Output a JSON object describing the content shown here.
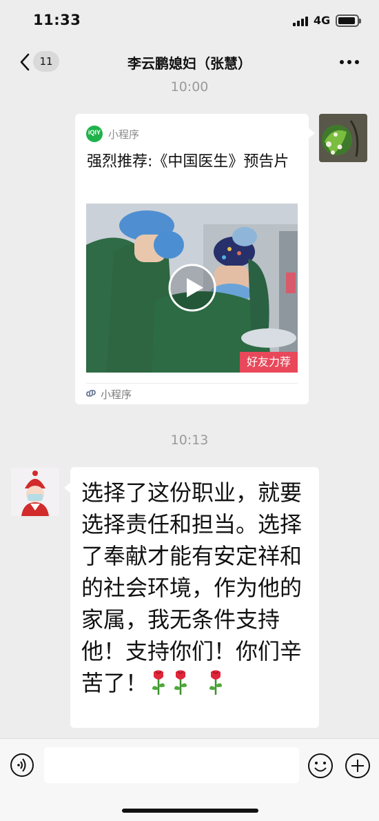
{
  "status_bar": {
    "time": "11:33",
    "network": "4G",
    "signal_icon": "cellular-signal-icon",
    "battery_icon": "battery-icon"
  },
  "nav": {
    "back_icon": "chevron-left-icon",
    "unread_count": "11",
    "title": "李云鹏媳妇（张慧）",
    "more_icon": "ellipsis-icon"
  },
  "messages": [
    {
      "timestamp": "10:00",
      "sender": "self",
      "type": "mini-program",
      "app_logo_text": "iQIY",
      "source": "小程序",
      "title": "强烈推荐:《中国医生》预告片",
      "badge": "好友力荐",
      "footer": "小程序",
      "footer_icon": "mini-program-icon"
    },
    {
      "timestamp": "10:13",
      "sender": "contact",
      "type": "text",
      "text": "选择了这份职业，就要选择责任和担当。选择了奉献才能有安定祥和的社会环境，作为他的家属，我无条件支持他！支持你们！你们辛苦了！",
      "emoji": [
        "rose-icon",
        "rose-icon",
        "rose-icon"
      ]
    }
  ],
  "input_bar": {
    "voice_icon": "voice-icon",
    "placeholder": "",
    "emoji_icon": "smiley-icon",
    "more_icon": "plus-icon"
  },
  "colors": {
    "background": "#ededed",
    "bubble": "#ffffff",
    "badge": "#e8485a",
    "iqiyi_green": "#1fb24a"
  }
}
